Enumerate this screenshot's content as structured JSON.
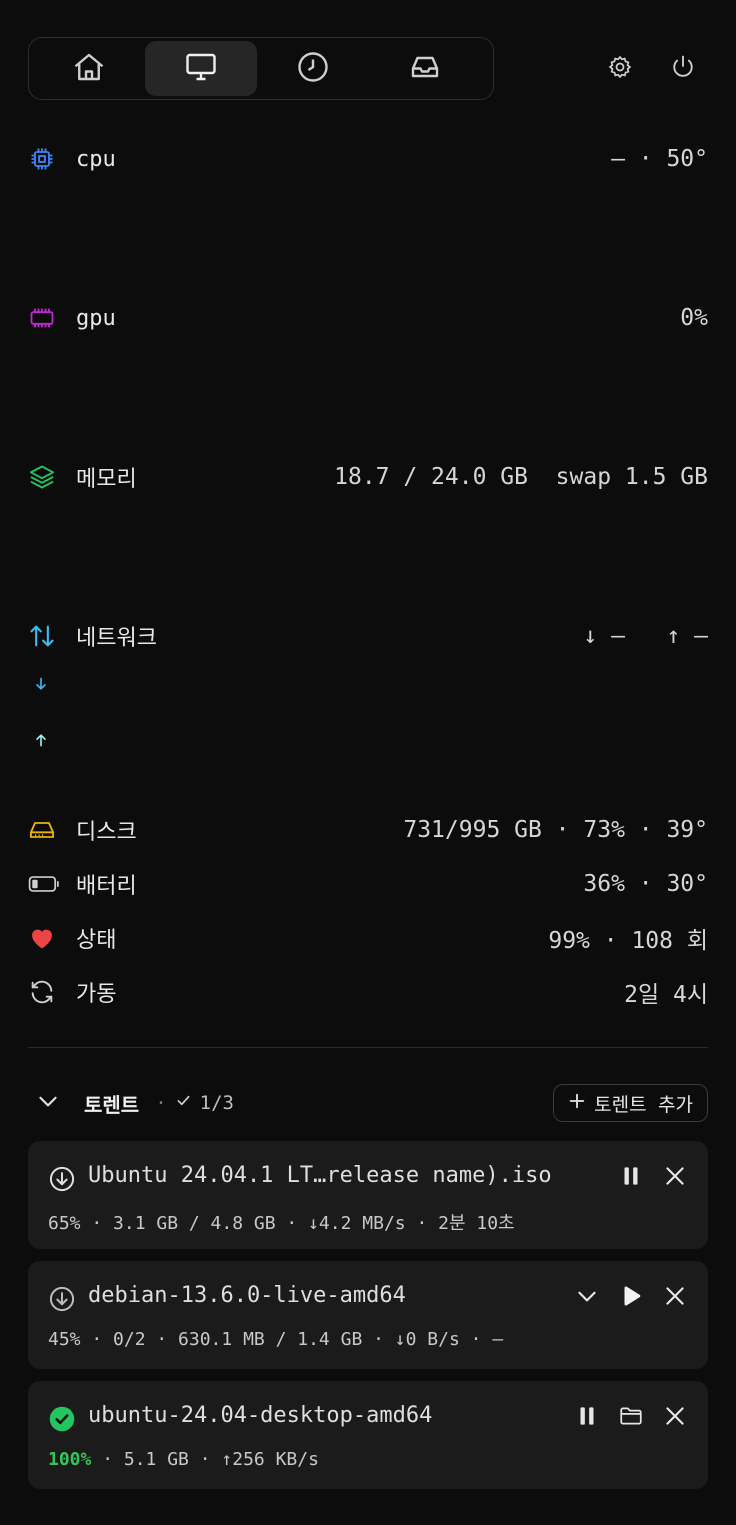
{
  "nav": {
    "tabs": [
      {
        "icon": "home-icon",
        "active": false
      },
      {
        "icon": "monitor-icon",
        "active": true
      },
      {
        "icon": "clock-icon",
        "active": false
      },
      {
        "icon": "inbox-icon",
        "active": false
      }
    ],
    "tools": [
      "settings-icon",
      "power-icon"
    ]
  },
  "metrics": {
    "cpu": {
      "label": "cpu",
      "value": "— · 50°",
      "color": "#3b82f6"
    },
    "gpu": {
      "label": "gpu",
      "value": "0%",
      "color": "#c026d3"
    },
    "memory": {
      "label": "메모리",
      "value": "18.7 / 24.0 GB  swap 1.5 GB",
      "color": "#22c55e"
    },
    "network": {
      "label": "네트워크",
      "value": "↓ —   ↑ —",
      "color": "#38bdf8"
    },
    "disk": {
      "label": "디스크",
      "value": "731/995 GB · 73% · 39°",
      "color": "#eab308"
    },
    "battery": {
      "label": "배터리",
      "value": "36% · 30°",
      "color": "#cfcfcf"
    },
    "health": {
      "label": "상태",
      "value": "99% · 108 회",
      "color": "#ef4444"
    },
    "uptime": {
      "label": "가동",
      "value": "2일 4시",
      "color": "#cfcfcf"
    }
  },
  "torrents": {
    "title": "토렌트",
    "count": "1/3",
    "add_label": "토렌트 추가",
    "items": [
      {
        "name": "Ubuntu 24.04.1 LT…release name).iso",
        "meta_percent": "65%",
        "meta_rest": " · 3.1 GB / 4.8 GB · ↓4.2 MB/s · 2분 10초",
        "state": "downloading",
        "actions": [
          "pause-icon",
          "close-icon"
        ]
      },
      {
        "name": "debian-13.6.0-live-amd64",
        "meta_percent": "45%",
        "meta_rest": " · 0/2 · 630.1 MB / 1.4 GB · ↓0 B/s · —",
        "state": "paused",
        "actions": [
          "chevron-down-icon",
          "play-icon",
          "close-icon"
        ]
      },
      {
        "name": "ubuntu-24.04-desktop-amd64",
        "meta_percent": "100%",
        "meta_rest": " · 5.1 GB · ↑256 KB/s",
        "state": "complete",
        "actions": [
          "pause-icon",
          "folder-icon",
          "close-icon"
        ]
      }
    ]
  }
}
